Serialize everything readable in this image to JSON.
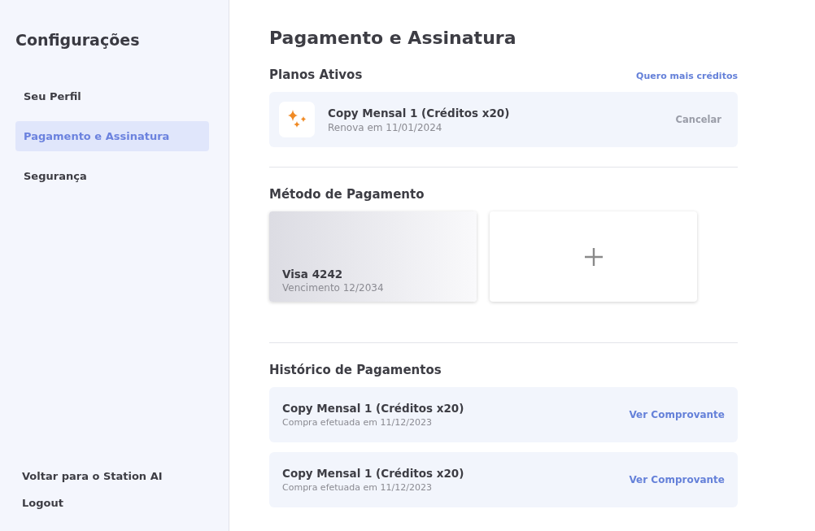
{
  "sidebar": {
    "title": "Configurações",
    "items": [
      {
        "label": "Seu Perfil",
        "selected": false
      },
      {
        "label": "Pagamento e Assinatura",
        "selected": true
      },
      {
        "label": "Segurança",
        "selected": false
      }
    ],
    "footer_links": [
      "Voltar para o Station AI",
      "Logout"
    ]
  },
  "page_title": "Pagamento e Assinatura",
  "active_plans": {
    "heading": "Planos Ativos",
    "action": "Quero mais créditos",
    "plans": [
      {
        "name": "Copy Mensal 1 (Créditos x20)",
        "renewal": "Renova em 11/01/2024",
        "cancel": {
          "label": "Cancelar",
          "disabled": true
        }
      }
    ]
  },
  "payment_method": {
    "heading": "Método de Pagamento",
    "cards": [
      {
        "name": "Visa 4242",
        "expiry": "Vencimento 12/2034"
      }
    ]
  },
  "history": {
    "heading": "Histórico de Pagamentos",
    "rows": [
      {
        "name": "Copy Mensal 1 (Créditos x20)",
        "date": "Compra efetuada em 11/12/2023",
        "action": "Ver Comprovante"
      },
      {
        "name": "Copy Mensal 1 (Créditos x20)",
        "date": "Compra efetuada em 11/12/2023",
        "action": "Ver Comprovante"
      }
    ]
  }
}
